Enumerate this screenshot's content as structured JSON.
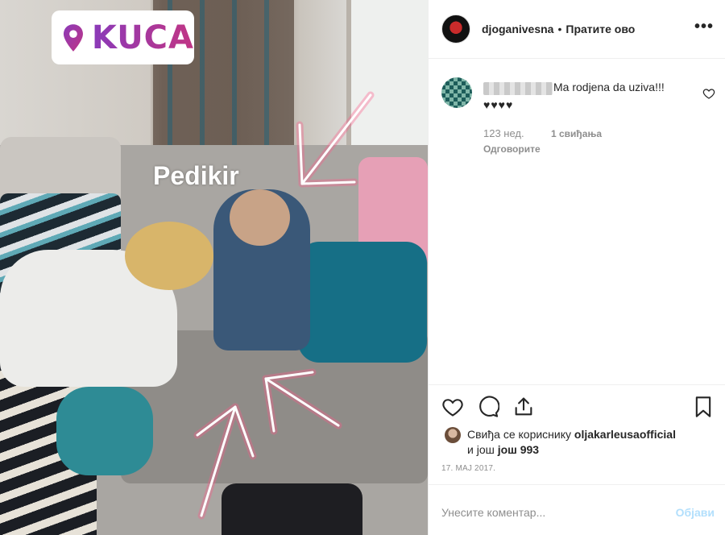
{
  "photo": {
    "location_sticker": "KUCA",
    "overlay_text": "Pedikir"
  },
  "header": {
    "username": "djoganivesna",
    "separator": "•",
    "follow_label": "Пратите ово",
    "more_label": "•••"
  },
  "comment": {
    "text": "Ma rodjena da uziva!!!",
    "hearts": "♥♥♥♥",
    "age": "123 нед.",
    "likes": "1 свиђања",
    "reply_label": "Одговорите"
  },
  "liked_by": {
    "prefix": "Свиђа се кориснику",
    "user": "oljakarleusaofficial",
    "and": "и још",
    "others": "још 993"
  },
  "date": "17. МАЈ 2017.",
  "add_comment": {
    "placeholder": "Унесите коментар...",
    "post_label": "Објави"
  },
  "colors": {
    "sticker_gradient_start": "#8a3ab9",
    "sticker_gradient_end": "#c13584",
    "post_button_disabled": "#b2dffc",
    "neon_arrow": "#ff5a8a"
  },
  "icons": {
    "location": "location-pin-icon",
    "like": "heart-icon",
    "comment": "speech-bubble-icon",
    "share": "share-icon",
    "save": "bookmark-icon",
    "more": "ellipsis-icon"
  }
}
